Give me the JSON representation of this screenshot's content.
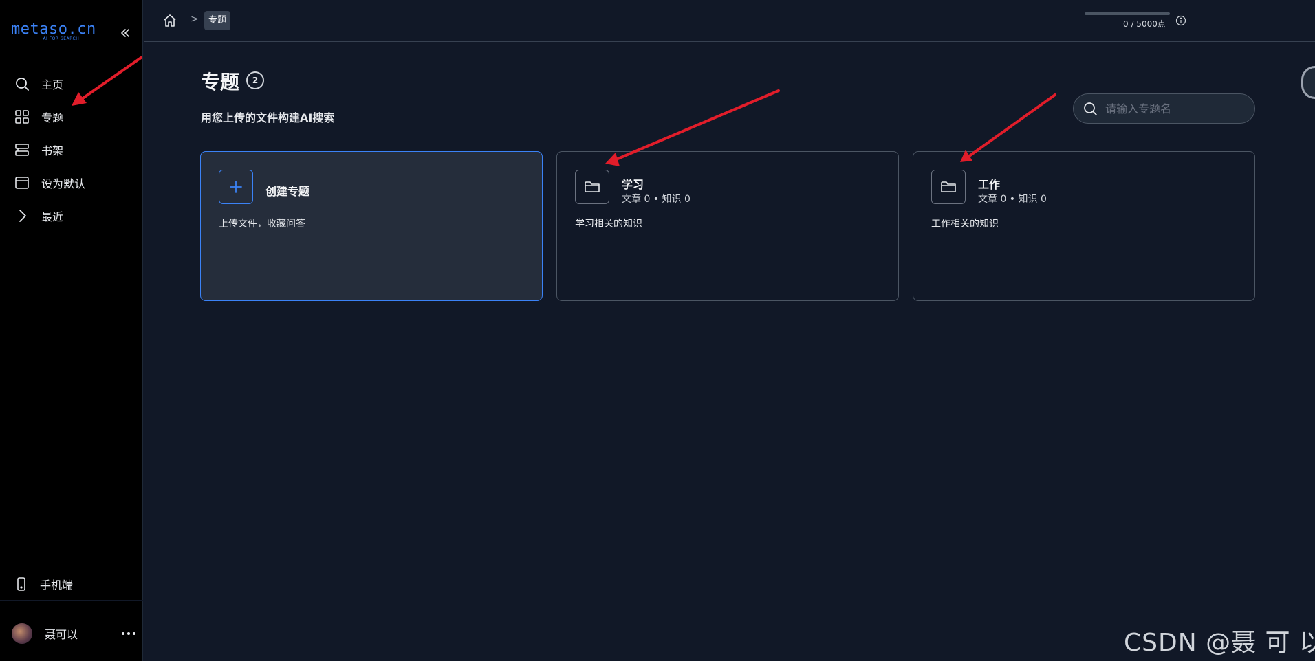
{
  "sidebar": {
    "logo": "metaso.cn",
    "logo_sub": "AI FOR SEARCH",
    "nav": [
      {
        "label": "主页",
        "icon": "search-icon"
      },
      {
        "label": "专题",
        "icon": "grid-icon"
      },
      {
        "label": "书架",
        "icon": "bookshelf-icon"
      },
      {
        "label": "设为默认",
        "icon": "browser-window-icon"
      },
      {
        "label": "最近",
        "icon": "chevron-right-icon"
      }
    ],
    "mobile_label": "手机端",
    "user_name": "聂可以"
  },
  "topbar": {
    "breadcrumb_separator": ">",
    "breadcrumb_current": "专题",
    "quota_text": "0 / 5000点",
    "quota_used_fraction": 0
  },
  "main": {
    "title": "专题",
    "count": "2",
    "subtitle": "用您上传的文件构建AI搜索",
    "search_placeholder": "请输入专题名",
    "create_card": {
      "name": "创建专题",
      "desc": "上传文件，收藏问答"
    },
    "topics": [
      {
        "name": "学习",
        "meta": "文章 0 • 知识 0",
        "desc": "学习相关的知识"
      },
      {
        "name": "工作",
        "meta": "文章 0 • 知识 0",
        "desc": "工作相关的知识"
      }
    ]
  },
  "watermark": "CSDN @聂 可 以",
  "colors": {
    "accent": "#3b82f6",
    "annotation_arrow": "#e11d2a",
    "background": "#111827",
    "sidebar_bg": "#000000"
  }
}
